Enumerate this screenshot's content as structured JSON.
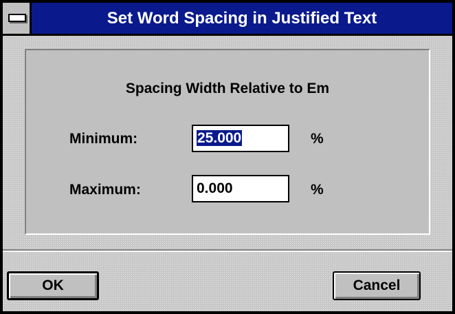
{
  "window": {
    "title": "Set Word Spacing in Justified Text"
  },
  "panel": {
    "heading": "Spacing Width Relative to Em",
    "fields": [
      {
        "label": "Minimum:",
        "value": "25.000",
        "unit": "%"
      },
      {
        "label": "Maximum:",
        "value": "0.000",
        "unit": "%"
      }
    ]
  },
  "buttons": {
    "ok_label": "OK",
    "cancel_label": "Cancel"
  },
  "colors": {
    "titlebar": "#0a1a8c",
    "selection": "#0a1a8c",
    "face": "#c0c0c0"
  },
  "icons": {
    "system_menu": "system-menu-icon"
  }
}
